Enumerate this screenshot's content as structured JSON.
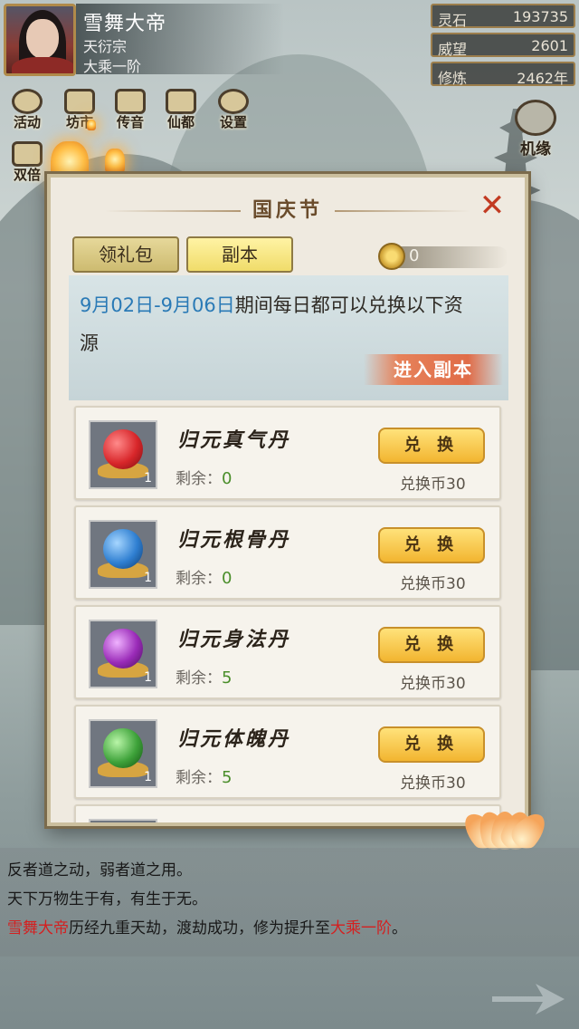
{
  "player": {
    "name": "雪舞大帝",
    "sect": "天衍宗",
    "realm": "大乘一阶"
  },
  "stats": [
    {
      "label": "灵石",
      "value": "193735"
    },
    {
      "label": "威望",
      "value": "2601"
    },
    {
      "label": "修炼",
      "value": "2462年"
    }
  ],
  "menu": {
    "row1": [
      "活动",
      "坊市",
      "传音",
      "仙都",
      "设置"
    ],
    "row2": [
      "双倍",
      "",
      "",
      "",
      ""
    ],
    "jiyuan": "机缘"
  },
  "dialog": {
    "title": "国庆节",
    "tabs": [
      "领礼包",
      "副本"
    ],
    "coin_value": "0",
    "info": {
      "date_range": "9月02日-9月06日",
      "text": "期间每日都可以兑换以下资源"
    },
    "enter_button": "进入副本",
    "items": [
      {
        "name": "归元真气丹",
        "remain_label": "剩余：",
        "remain": "0",
        "qty": "1",
        "button": "兑 换",
        "cost": "兑换币30",
        "color": "#d8262a"
      },
      {
        "name": "归元根骨丹",
        "remain_label": "剩余：",
        "remain": "0",
        "qty": "1",
        "button": "兑 换",
        "cost": "兑换币30",
        "color": "#2f7fd1"
      },
      {
        "name": "归元身法丹",
        "remain_label": "剩余：",
        "remain": "5",
        "qty": "1",
        "button": "兑 换",
        "cost": "兑换币30",
        "color": "#9a2bb8"
      },
      {
        "name": "归元体魄丹",
        "remain_label": "剩余：",
        "remain": "5",
        "qty": "1",
        "button": "兑 换",
        "cost": "兑换币30",
        "color": "#3ea23a"
      }
    ]
  },
  "chat": {
    "line1": "反者道之动，弱者道之用。",
    "line2": "天下万物生于有，有生于无。",
    "line3_name": "雪舞大帝",
    "line3_mid": "历经九重天劫，渡劫成功，修为提升至",
    "line3_realm": "大乘一阶",
    "line3_end": "。"
  },
  "colors": {
    "accent_gold": "#f2b530",
    "highlight_red": "#d42020",
    "date_blue": "#2a7ab6",
    "close_red": "#c23b22"
  }
}
